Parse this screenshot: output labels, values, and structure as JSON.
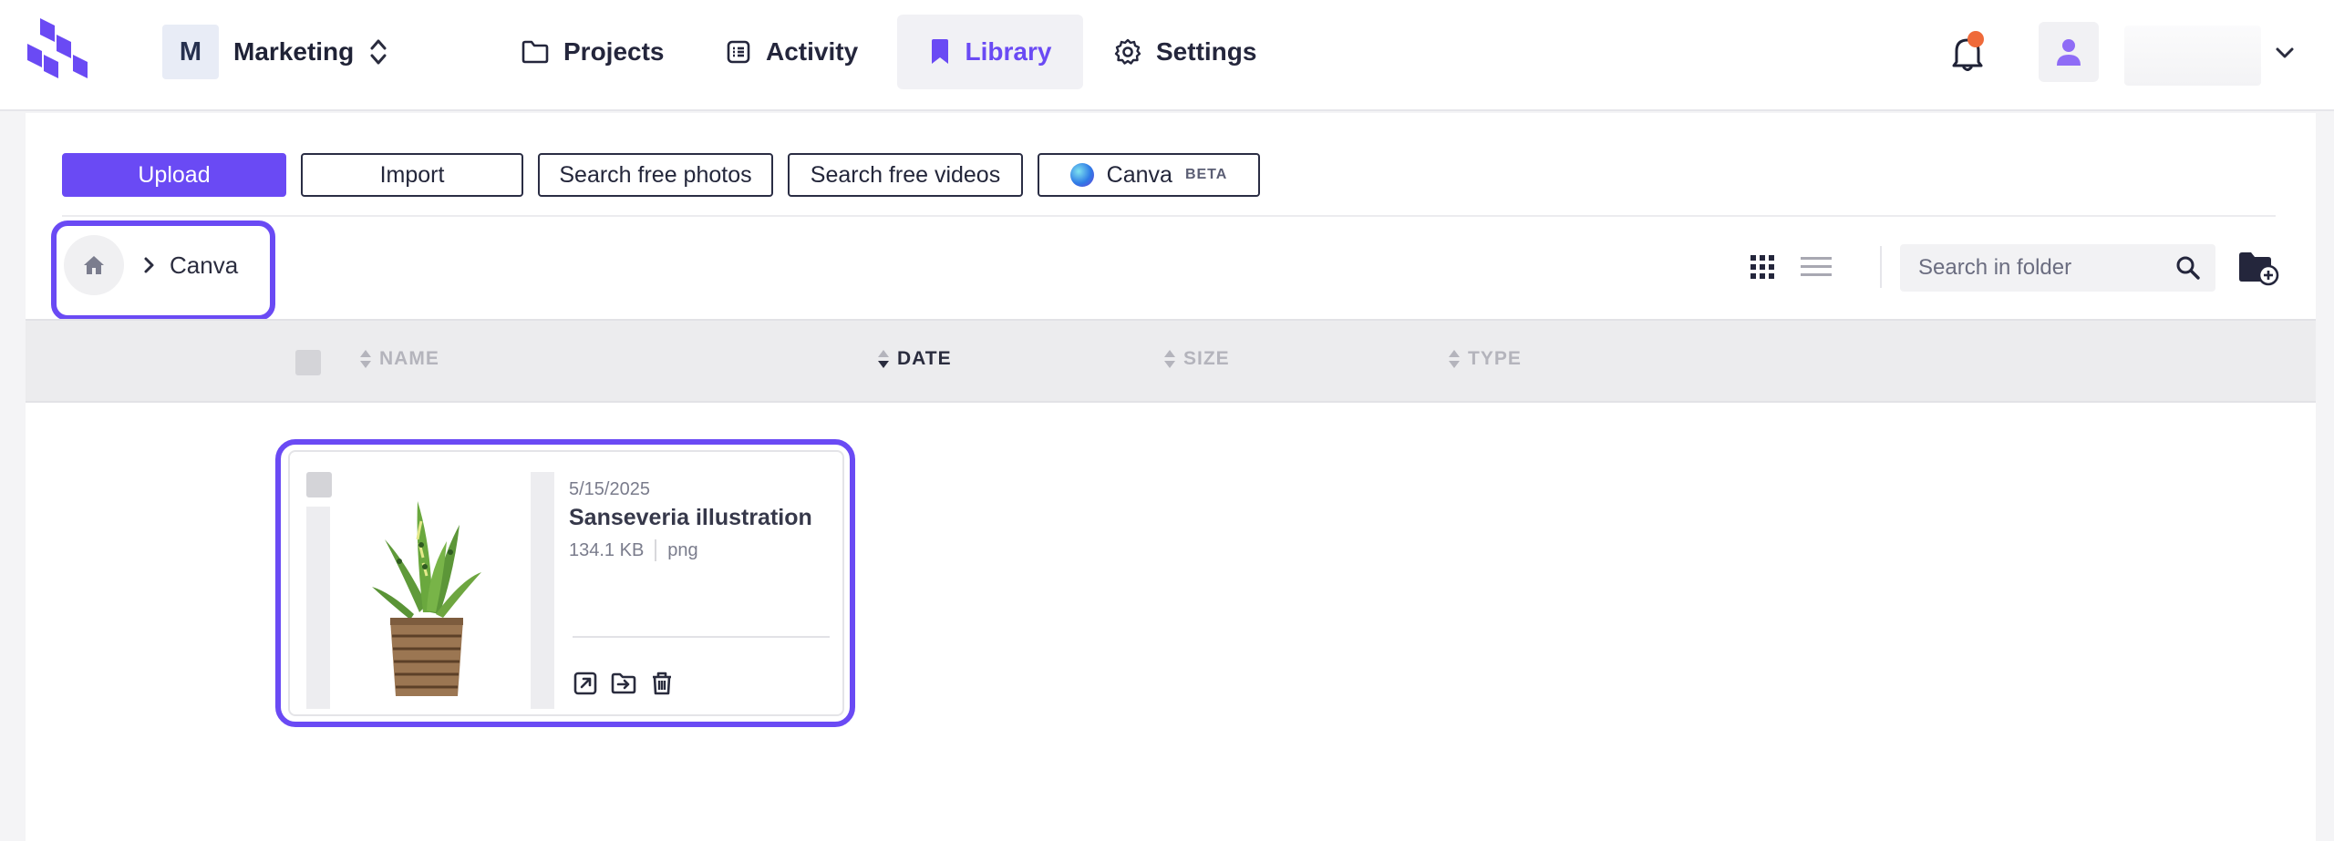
{
  "workspace": {
    "initial": "M",
    "name": "Marketing"
  },
  "nav": {
    "projects": "Projects",
    "activity": "Activity",
    "library": "Library",
    "settings": "Settings"
  },
  "toolbar": {
    "upload": "Upload",
    "import": "Import",
    "search_photos": "Search free photos",
    "search_videos": "Search free videos",
    "canva": "Canva",
    "canva_badge": "BETA"
  },
  "breadcrumb": {
    "current": "Canva"
  },
  "search": {
    "placeholder": "Search in folder"
  },
  "table": {
    "columns": {
      "name": "NAME",
      "date": "DATE",
      "size": "SIZE",
      "type": "TYPE"
    }
  },
  "files": [
    {
      "date": "5/15/2025",
      "name": "Sanseveria illustration",
      "size": "134.1 KB",
      "type": "png"
    }
  ],
  "colors": {
    "accent": "#6a4af4",
    "notification": "#ef6a3a"
  }
}
